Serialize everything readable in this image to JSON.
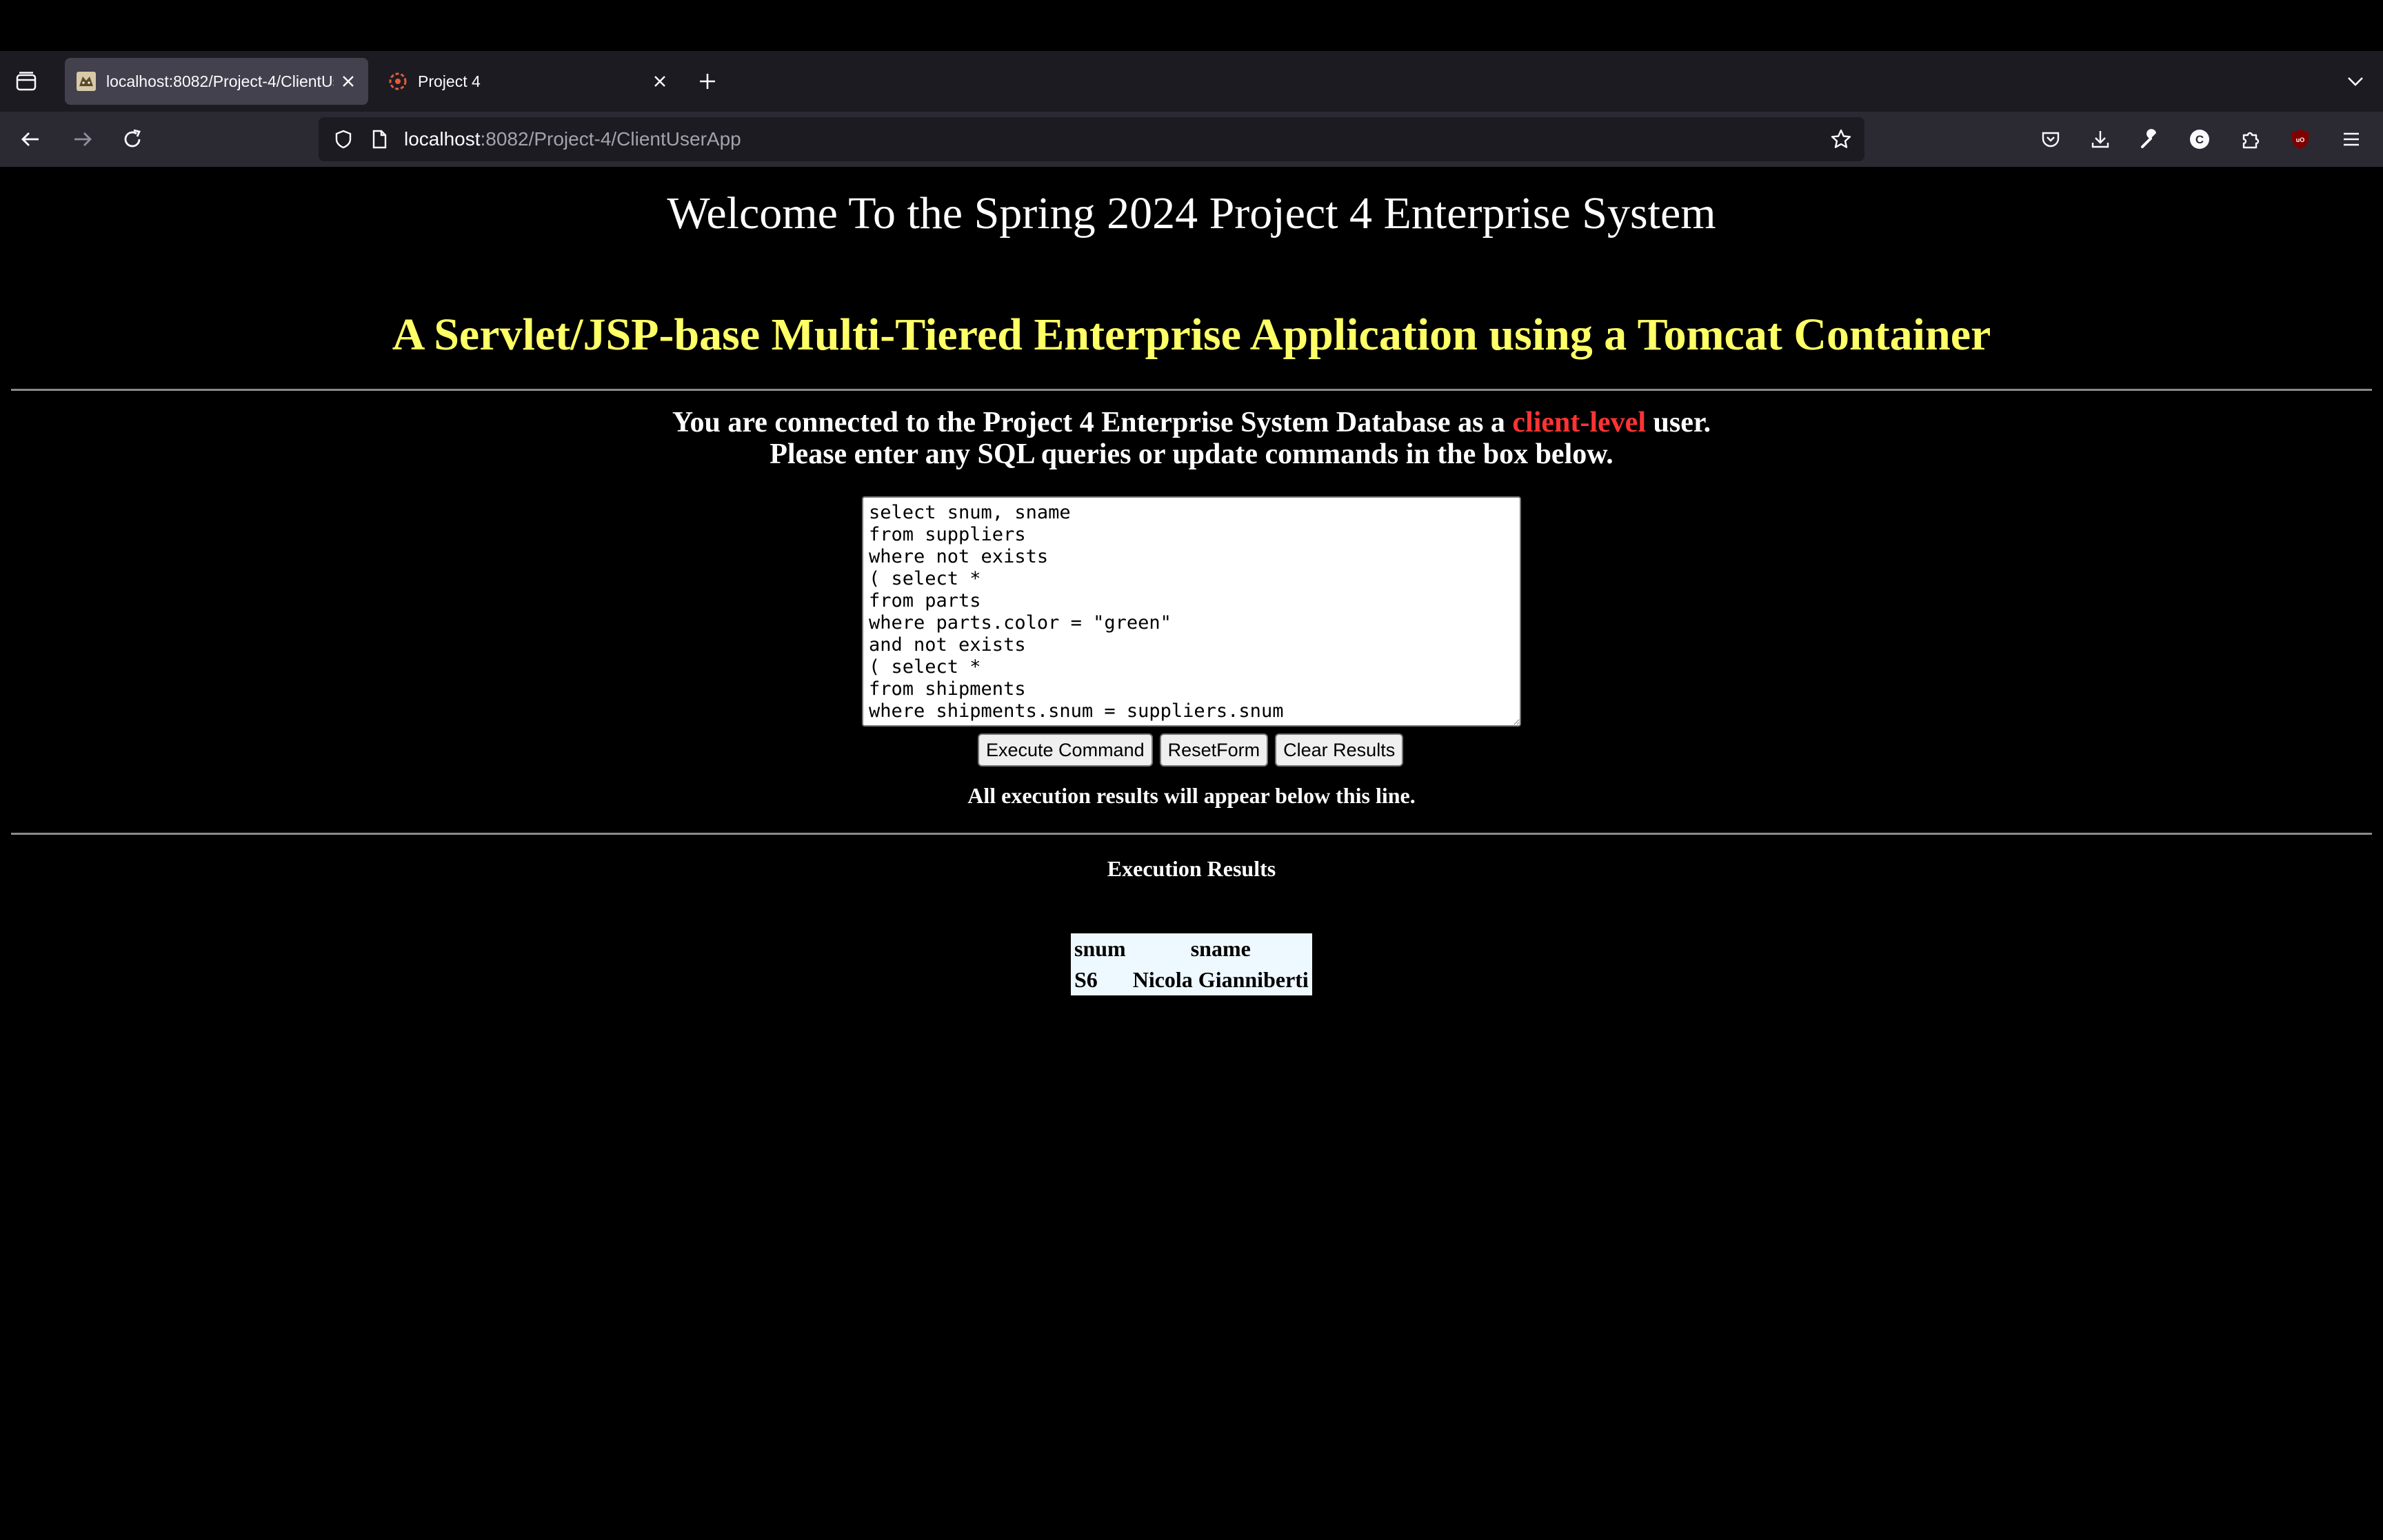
{
  "browser": {
    "tabs": [
      {
        "label": "localhost:8082/Project-4/ClientUserApp",
        "active": true
      },
      {
        "label": "Project 4",
        "active": false
      }
    ],
    "url": {
      "host": "localhost",
      "rest": ":8082/Project-4/ClientUserApp"
    },
    "icons": {
      "tab_overview": "tab-overview-icon",
      "new_tab": "plus-icon",
      "tab_list": "chevron-down-icon",
      "back": "back-arrow-icon",
      "forward": "forward-arrow-icon",
      "reload": "reload-icon",
      "shield": "shield-icon",
      "page": "page-icon",
      "bookmark": "star-icon",
      "pocket": "pocket-icon",
      "downloads": "download-icon",
      "tools": "wrench-icon",
      "account": "account-icon",
      "extensions": "puzzle-icon",
      "ublock": "ublock-icon",
      "menu": "hamburger-menu-icon"
    }
  },
  "page": {
    "welcome": "Welcome To the Spring 2024 Project 4 Enterprise System",
    "subtitle": "A Servlet/JSP-base Multi-Tiered Enterprise Application using a Tomcat Container",
    "connected_prefix": "You are connected to the Project 4 Enterprise System Database as a ",
    "connected_level": "client-level",
    "connected_suffix": " user.",
    "instructions": "Please enter any SQL queries or update commands in the box below.",
    "sql_text": "select snum, sname\nfrom suppliers\nwhere not exists\n( select *\nfrom parts\nwhere parts.color = \"green\"\nand not exists\n( select *\nfrom shipments\nwhere shipments.snum = suppliers.snum",
    "buttons": {
      "execute": "Execute Command",
      "reset": "ResetForm",
      "clear": "Clear Results"
    },
    "results_note": "All execution results will appear below this line.",
    "results_title": "Execution Results",
    "table": {
      "headers": [
        "snum",
        "sname"
      ],
      "rows": [
        [
          "S6",
          "Nicola Gianniberti"
        ]
      ]
    },
    "colors": {
      "background": "#000000",
      "subtitle": "#ffff66",
      "client_level": "#ff3333",
      "table_bg": "#eef8ff"
    }
  }
}
